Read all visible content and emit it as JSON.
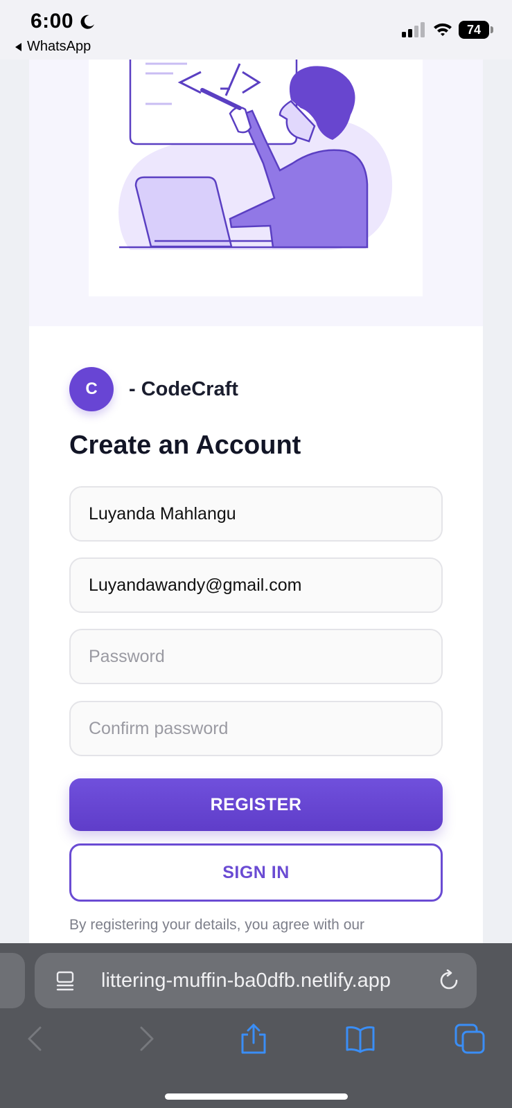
{
  "status_bar": {
    "time": "6:00",
    "back_app": "WhatsApp",
    "battery": "74"
  },
  "hero": {
    "image_name": "developer-coding-illustration"
  },
  "brand": {
    "initial": "C",
    "name": "- CodeCraft"
  },
  "form": {
    "title": "Create an Account",
    "name_value": "Luyanda Mahlangu",
    "email_value": "Luyandawandy@gmail.com",
    "password_placeholder": "Password",
    "confirm_placeholder": "Confirm password",
    "register_label": "REGISTER",
    "signin_label": "SIGN IN",
    "terms_text": "By registering your details, you agree with our"
  },
  "browser": {
    "url": "littering-muffin-ba0dfb.netlify.app"
  },
  "colors": {
    "accent": "#6845d4",
    "browser_chrome": "#55575c",
    "toolbar_icon_active": "#3a8ef6",
    "toolbar_icon_disabled": "#77797e"
  }
}
